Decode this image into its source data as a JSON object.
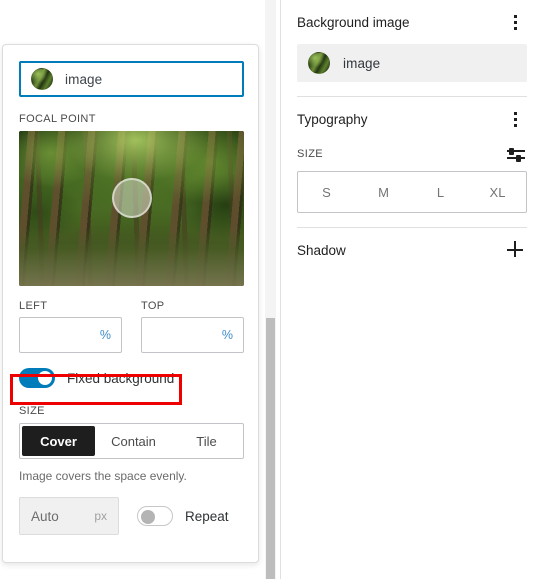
{
  "left_panel": {
    "media_picker": {
      "value": "image",
      "thumbnail_icon": "forest-image-thumbnail"
    },
    "focal_point": {
      "label": "FOCAL POINT",
      "image_icon": "forest-photo",
      "handle_icon": "focal-point-handle"
    },
    "coordinates": [
      {
        "label": "LEFT",
        "value": "",
        "unit": "%"
      },
      {
        "label": "TOP",
        "value": "",
        "unit": "%"
      }
    ],
    "fixed_background": {
      "label": "Fixed background",
      "state": "on",
      "highlight_color": "#ee0000"
    },
    "size": {
      "label": "SIZE",
      "options": [
        "Cover",
        "Contain",
        "Tile"
      ],
      "selected": "Cover",
      "helper_text": "Image covers the space evenly."
    },
    "width_field": {
      "value": "Auto",
      "unit": "px"
    },
    "repeat": {
      "label": "Repeat",
      "state": "off"
    },
    "scrollbar": {
      "thumb_color": "#bdbdbd",
      "track_color": "#f4f4f4"
    }
  },
  "right_panel": {
    "background_image": {
      "title": "Background image",
      "menu_icon": "kebab-menu-icon",
      "media_value": "image",
      "thumbnail_icon": "forest-image-thumbnail"
    },
    "typography": {
      "title": "Typography",
      "menu_icon": "kebab-menu-icon",
      "size_label": "SIZE",
      "settings_icon": "sliders-icon",
      "size_options": [
        "S",
        "M",
        "L",
        "XL"
      ]
    },
    "shadow": {
      "title": "Shadow",
      "add_icon": "plus-icon"
    }
  },
  "theme": {
    "accent": "#007cba",
    "active_segment_bg": "#1e1e1e",
    "unit_color": "#3f8ecb"
  }
}
